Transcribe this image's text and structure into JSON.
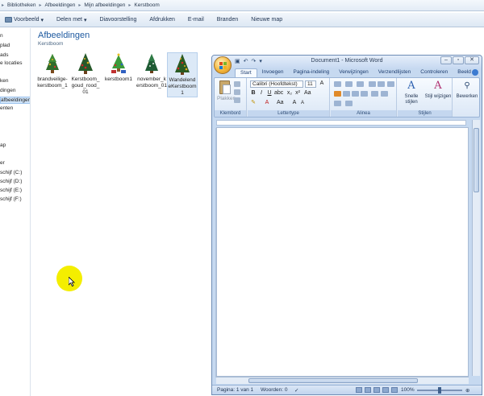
{
  "explorer": {
    "breadcrumb": [
      "Bibliotheken",
      "Afbeeldingen",
      "Mijn afbeeldingen",
      "Kerstboom"
    ],
    "toolbar": {
      "items": [
        "Voorbeeld",
        "Delen met",
        "Diavoorstelling",
        "Afdrukken",
        "E-mail",
        "Branden",
        "Nieuwe map"
      ]
    },
    "nav": {
      "items": [
        "n",
        "plad",
        "ads",
        "e locaties",
        "ken",
        "dingen",
        "afbeeldingen",
        "enten",
        "ap",
        "er",
        "schijf (C:)",
        "schijf (D:)",
        "schijf (E:)",
        "schijf (F:)"
      ],
      "selected_index": 6
    },
    "library": {
      "title": "Afbeeldingen",
      "subtitle": "Kerstboom"
    },
    "files": [
      {
        "name": "brandveilige-kerstboom_1",
        "icon": "christmas-tree-icon"
      },
      {
        "name": "Kerstboom_goud_rood_01",
        "icon": "christmas-tree-icon"
      },
      {
        "name": "kerstboom1",
        "icon": "christmas-tree-icon"
      },
      {
        "name": "november_kerstboom_01",
        "icon": "christmas-tree-icon"
      },
      {
        "name": "WandelendeKerstboom1",
        "icon": "christmas-tree-icon",
        "selected": true
      }
    ]
  },
  "word": {
    "title": "Document1 - Microsoft Word",
    "tabs": [
      "Start",
      "Invoegen",
      "Pagina-indeling",
      "Verwijzingen",
      "Verzendlijsten",
      "Controleren",
      "Beeld"
    ],
    "active_tab": "Start",
    "clipboard": {
      "paste_label": "Plakken",
      "group": "Klembord"
    },
    "font": {
      "name": "Calibri (Hoofdtekst)",
      "size": "11",
      "group": "Lettertype"
    },
    "paragraph": {
      "group": "Alinea"
    },
    "styles": {
      "quick_label": "Snelle stijlen",
      "change_label": "Stijl wijzigen",
      "group": "Stijlen"
    },
    "editing": {
      "label": "Bewerken"
    },
    "status": {
      "page": "Pagina: 1 van 1",
      "words": "Woorden: 0",
      "zoom": "100%"
    }
  },
  "colors": {
    "cursor_highlight": "#f4ee00",
    "library_title": "#1e5aa0",
    "ribbon_bg": "#dbe7f6"
  }
}
